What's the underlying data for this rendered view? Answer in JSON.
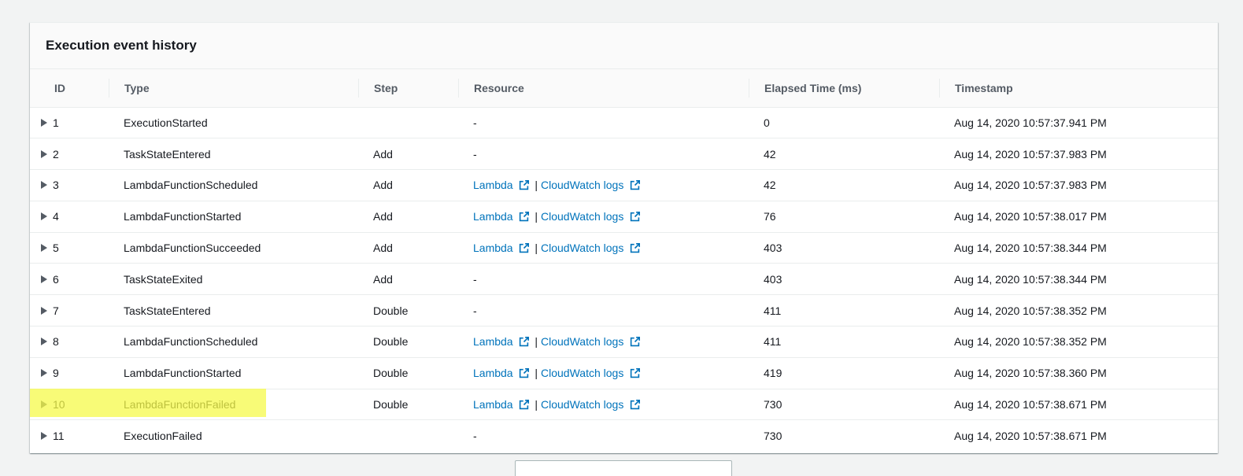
{
  "panel": {
    "title": "Execution event history"
  },
  "table": {
    "headers": [
      "ID",
      "Type",
      "Step",
      "Resource",
      "Elapsed Time (ms)",
      "Timestamp"
    ],
    "rows": [
      {
        "id": "1",
        "type": "ExecutionStarted",
        "step": "",
        "resource": "-",
        "elapsed": "0",
        "timestamp": "Aug 14, 2020 10:57:37.941 PM"
      },
      {
        "id": "2",
        "type": "TaskStateEntered",
        "step": "Add",
        "resource": "-",
        "elapsed": "42",
        "timestamp": "Aug 14, 2020 10:57:37.983 PM"
      },
      {
        "id": "3",
        "type": "LambdaFunctionScheduled",
        "step": "Add",
        "resource": "links",
        "elapsed": "42",
        "timestamp": "Aug 14, 2020 10:57:37.983 PM"
      },
      {
        "id": "4",
        "type": "LambdaFunctionStarted",
        "step": "Add",
        "resource": "links",
        "elapsed": "76",
        "timestamp": "Aug 14, 2020 10:57:38.017 PM"
      },
      {
        "id": "5",
        "type": "LambdaFunctionSucceeded",
        "step": "Add",
        "resource": "links",
        "elapsed": "403",
        "timestamp": "Aug 14, 2020 10:57:38.344 PM"
      },
      {
        "id": "6",
        "type": "TaskStateExited",
        "step": "Add",
        "resource": "-",
        "elapsed": "403",
        "timestamp": "Aug 14, 2020 10:57:38.344 PM"
      },
      {
        "id": "7",
        "type": "TaskStateEntered",
        "step": "Double",
        "resource": "-",
        "elapsed": "411",
        "timestamp": "Aug 14, 2020 10:57:38.352 PM"
      },
      {
        "id": "8",
        "type": "LambdaFunctionScheduled",
        "step": "Double",
        "resource": "links",
        "elapsed": "411",
        "timestamp": "Aug 14, 2020 10:57:38.352 PM"
      },
      {
        "id": "9",
        "type": "LambdaFunctionStarted",
        "step": "Double",
        "resource": "links",
        "elapsed": "419",
        "timestamp": "Aug 14, 2020 10:57:38.360 PM"
      },
      {
        "id": "10",
        "type": "LambdaFunctionFailed",
        "step": "Double",
        "resource": "links",
        "elapsed": "730",
        "timestamp": "Aug 14, 2020 10:57:38.671 PM",
        "highlighted": true
      },
      {
        "id": "11",
        "type": "ExecutionFailed",
        "step": "",
        "resource": "-",
        "elapsed": "730",
        "timestamp": "Aug 14, 2020 10:57:38.671 PM"
      }
    ]
  },
  "links": {
    "lambda": "Lambda",
    "separator": "|",
    "cloudwatch": "CloudWatch logs"
  },
  "icons": {
    "expand": "caret-right-icon",
    "external": "external-link-icon"
  },
  "colors": {
    "link": "#0073bb",
    "highlight": "#f6f94a",
    "header_text": "#545b64"
  }
}
